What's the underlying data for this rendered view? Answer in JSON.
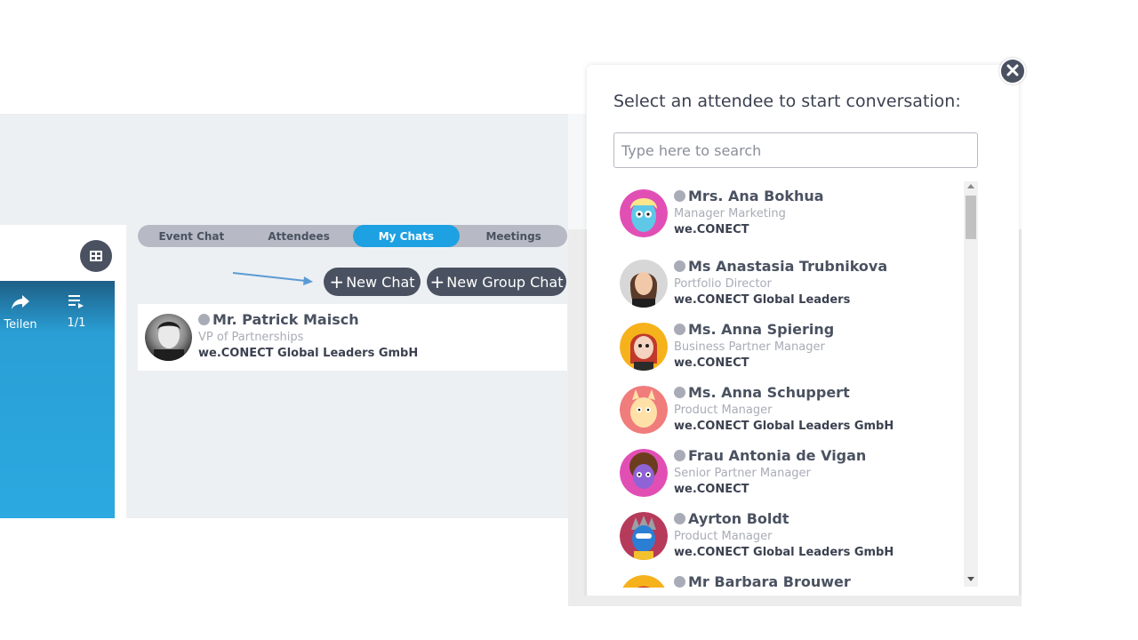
{
  "left_panel": {
    "share_label": "Teilen",
    "playlist_count": "1/1",
    "grid_icon": "grid-icon",
    "video_colors": [
      "#1d5f86",
      "#2ba9e0"
    ]
  },
  "tabs": [
    {
      "label": "Event Chat",
      "active": false
    },
    {
      "label": "Attendees",
      "active": false
    },
    {
      "label": "My Chats",
      "active": true
    },
    {
      "label": "Meetings",
      "active": false
    }
  ],
  "actions": {
    "new_chat": "New Chat",
    "new_group_chat": "New Group Chat"
  },
  "my_chats": [
    {
      "name": "Mr. Patrick Maisch",
      "role": "VP of Partnerships",
      "company": "we.CONECT Global Leaders GmbH",
      "status": "offline"
    }
  ],
  "modal": {
    "title": "Select an attendee to start conversation:",
    "search_placeholder": "Type here to search",
    "search_value": "",
    "attendees": [
      {
        "name": "Mrs. Ana Bokhua",
        "role": "Manager Marketing",
        "company": "we.CONECT",
        "status": "offline"
      },
      {
        "name": "Ms Anastasia Trubnikova",
        "role": "Portfolio Director",
        "company": "we.CONECT Global Leaders",
        "status": "offline"
      },
      {
        "name": "Ms. Anna Spiering",
        "role": "Business Partner Manager",
        "company": "we.CONECT",
        "status": "offline"
      },
      {
        "name": "Ms. Anna Schuppert",
        "role": "Product Manager",
        "company": "we.CONECT Global Leaders GmbH",
        "status": "offline"
      },
      {
        "name": "Frau Antonia de Vigan",
        "role": "Senior Partner Manager",
        "company": "we.CONECT",
        "status": "offline"
      },
      {
        "name": "Ayrton Boldt",
        "role": "Product Manager",
        "company": "we.CONECT Global Leaders GmbH",
        "status": "offline"
      },
      {
        "name": "Mr Barbara Brouwer",
        "role": "",
        "company": "",
        "status": "offline"
      }
    ]
  },
  "colors": {
    "accent": "#1da1e2",
    "dark_button": "#4a5261",
    "status_offline": "#a9acb6"
  }
}
